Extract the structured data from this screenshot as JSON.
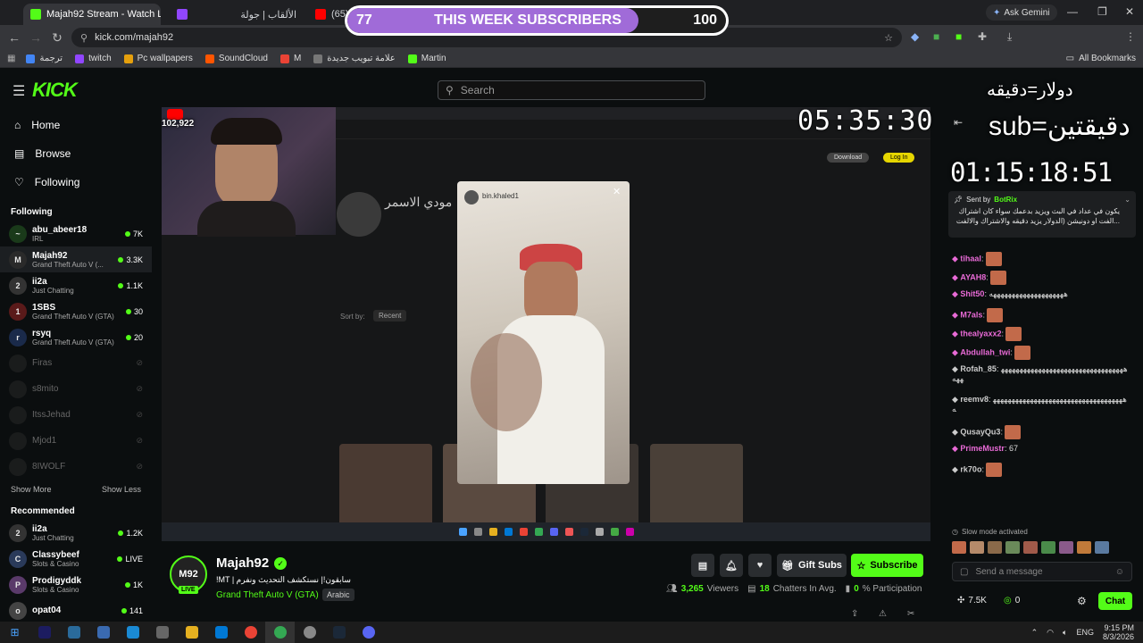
{
  "browser": {
    "tabs": [
      {
        "label": "Majah92 Stream - Watch Live o",
        "icon_color": "#53fc18",
        "active": true
      },
      {
        "label": "الألقاب | جولة",
        "icon_color": "#888888"
      },
      {
        "label": "(65) Y",
        "icon_color": "#ff0000"
      }
    ],
    "ask_gemini": "Ask Gemini",
    "url": "kick.com/majah92",
    "bookmarks": [
      {
        "label": "ترجمة",
        "icon_color": "#4285f4"
      },
      {
        "label": "twitch",
        "icon_color": "#9146ff"
      },
      {
        "label": "Pc wallpapers",
        "icon_color": "#e5a00d"
      },
      {
        "label": "SoundCloud",
        "icon_color": "#ff5500"
      },
      {
        "label": "M",
        "icon_color": "#ea4335"
      },
      {
        "label": "علامة تبويب جديدة",
        "icon_color": "#777777"
      },
      {
        "label": "Martin",
        "icon_color": "#53fc18"
      }
    ],
    "all_bookmarks": "All Bookmarks"
  },
  "sub_goal": {
    "current": "77",
    "label": "THIS WEEK SUBSCRIBERS",
    "target": "100",
    "progress": 0.77
  },
  "site": {
    "logo": "KICK",
    "search_placeholder": "Search",
    "nav": [
      {
        "label": "Home",
        "icon": "home-icon"
      },
      {
        "label": "Browse",
        "icon": "browse-icon"
      },
      {
        "label": "Following",
        "icon": "heart-icon"
      }
    ],
    "following_heading": "Following",
    "following": [
      {
        "name": "abu_abeer18",
        "game": "IRL",
        "viewers": "7K",
        "color": "#1a3a1a",
        "initial": "~"
      },
      {
        "name": "Majah92",
        "game": "Grand Theft Auto V (...",
        "viewers": "3.3K",
        "color": "#2a2a2a",
        "initial": "M"
      },
      {
        "name": "ii2a",
        "game": "Just Chatting",
        "viewers": "1.1K",
        "color": "#333333",
        "initial": "2"
      },
      {
        "name": "1SBS",
        "game": "Grand Theft Auto V (GTA)",
        "viewers": "30",
        "color": "#5a1a1a",
        "initial": "1"
      },
      {
        "name": "rsyq",
        "game": "Grand Theft Auto V (GTA)",
        "viewers": "20",
        "color": "#1a2a4a",
        "initial": "r"
      }
    ],
    "offline": [
      "Firas",
      "s8mito",
      "ItssJehad",
      "Mjod1",
      "8IWOLF"
    ],
    "show_more": "Show More",
    "show_less": "Show Less",
    "recommended_heading": "Recommended",
    "recommended": [
      {
        "name": "ii2a",
        "game": "Just Chatting",
        "viewers": "1.2K",
        "color": "#333333",
        "initial": "2"
      },
      {
        "name": "Classybeef",
        "game": "Slots & Casino",
        "viewers": "LIVE",
        "color": "#2a3a5a",
        "initial": "C"
      },
      {
        "name": "Prodigyddk",
        "game": "Slots & Casino",
        "viewers": "1K",
        "color": "#5a3a6a",
        "initial": "P"
      },
      {
        "name": "opat04",
        "game": "",
        "viewers": "141",
        "color": "#444444",
        "initial": "o"
      }
    ]
  },
  "stream": {
    "yt_count": "102,922",
    "clock": "05:35:30",
    "overlay_line1": "دولار=دقيقه",
    "overlay_line2": "sub=دقيقتين",
    "countdown": "01:15:18:51",
    "phone_user": "bin.khaled1",
    "profile_name": "مودي الاسمر",
    "sort_label": "Sort by:",
    "sort_value": "Recent",
    "download": "Download",
    "login": "Log In"
  },
  "channel": {
    "name": "Majah92",
    "live": "LIVE",
    "title": "!MT | سابقون!| نستكشف التحديث ونفرم",
    "category": "Grand Theft Auto V (GTA)",
    "language": "Arabic",
    "gift_subs": "Gift Subs",
    "subscribe": "Subscribe",
    "viewers": "3,265",
    "viewers_label": "Viewers",
    "chatters": "18",
    "chatters_label": "Chatters In Avg.",
    "participation": "0",
    "participation_label": "% Participation"
  },
  "chat": {
    "pinned_by_label": "Sent by",
    "pinned_by": "BotRix",
    "pinned_text": "يكون في عداد في البث ويزيد بدعمك سواء كان اشتراك ...الفت او دونيشن (الدولار يزيد دقيقه والاشتراك والالفت",
    "messages": [
      {
        "user": "tihaal",
        "text": "",
        "color": "#e86ad6",
        "emote": true
      },
      {
        "user": "AYAH8",
        "text": "",
        "color": "#e86ad6",
        "emote": true
      },
      {
        "user": "Shit50",
        "text": "ههههههههههههههههههههه",
        "color": "#e86ad6",
        "emote": false
      },
      {
        "user": "M7als",
        "text": "",
        "color": "#e86ad6",
        "emote": true
      },
      {
        "user": "thealyaxx2",
        "text": "",
        "color": "#e86ad6",
        "emote": true
      },
      {
        "user": "Abdullah_twi",
        "text": "",
        "color": "#e86ad6",
        "emote": true
      },
      {
        "user": "Rofah_85",
        "text": "ههههههههههههههههههههههههههههههههههههه",
        "color": "#cccccc",
        "emote": false
      },
      {
        "user": "reemv8",
        "text": "ههههههههههههههههههههههههههههههههههههه",
        "color": "#cccccc",
        "emote": false
      },
      {
        "user": "QusayQu3",
        "text": "",
        "color": "#cccccc",
        "emote": true
      },
      {
        "user": "PrimeMustr",
        "text": "67",
        "color": "#e86ad6",
        "emote": false
      },
      {
        "user": "rk70o",
        "text": "",
        "color": "#cccccc",
        "emote": true
      }
    ],
    "slow_mode": "Slow mode activated",
    "input_placeholder": "Send a message",
    "kicks": "7.5K",
    "points": "0",
    "chat_button": "Chat"
  },
  "taskbar": {
    "time": "9:15 PM",
    "date": "8/3/2026",
    "lang": "ENG"
  }
}
